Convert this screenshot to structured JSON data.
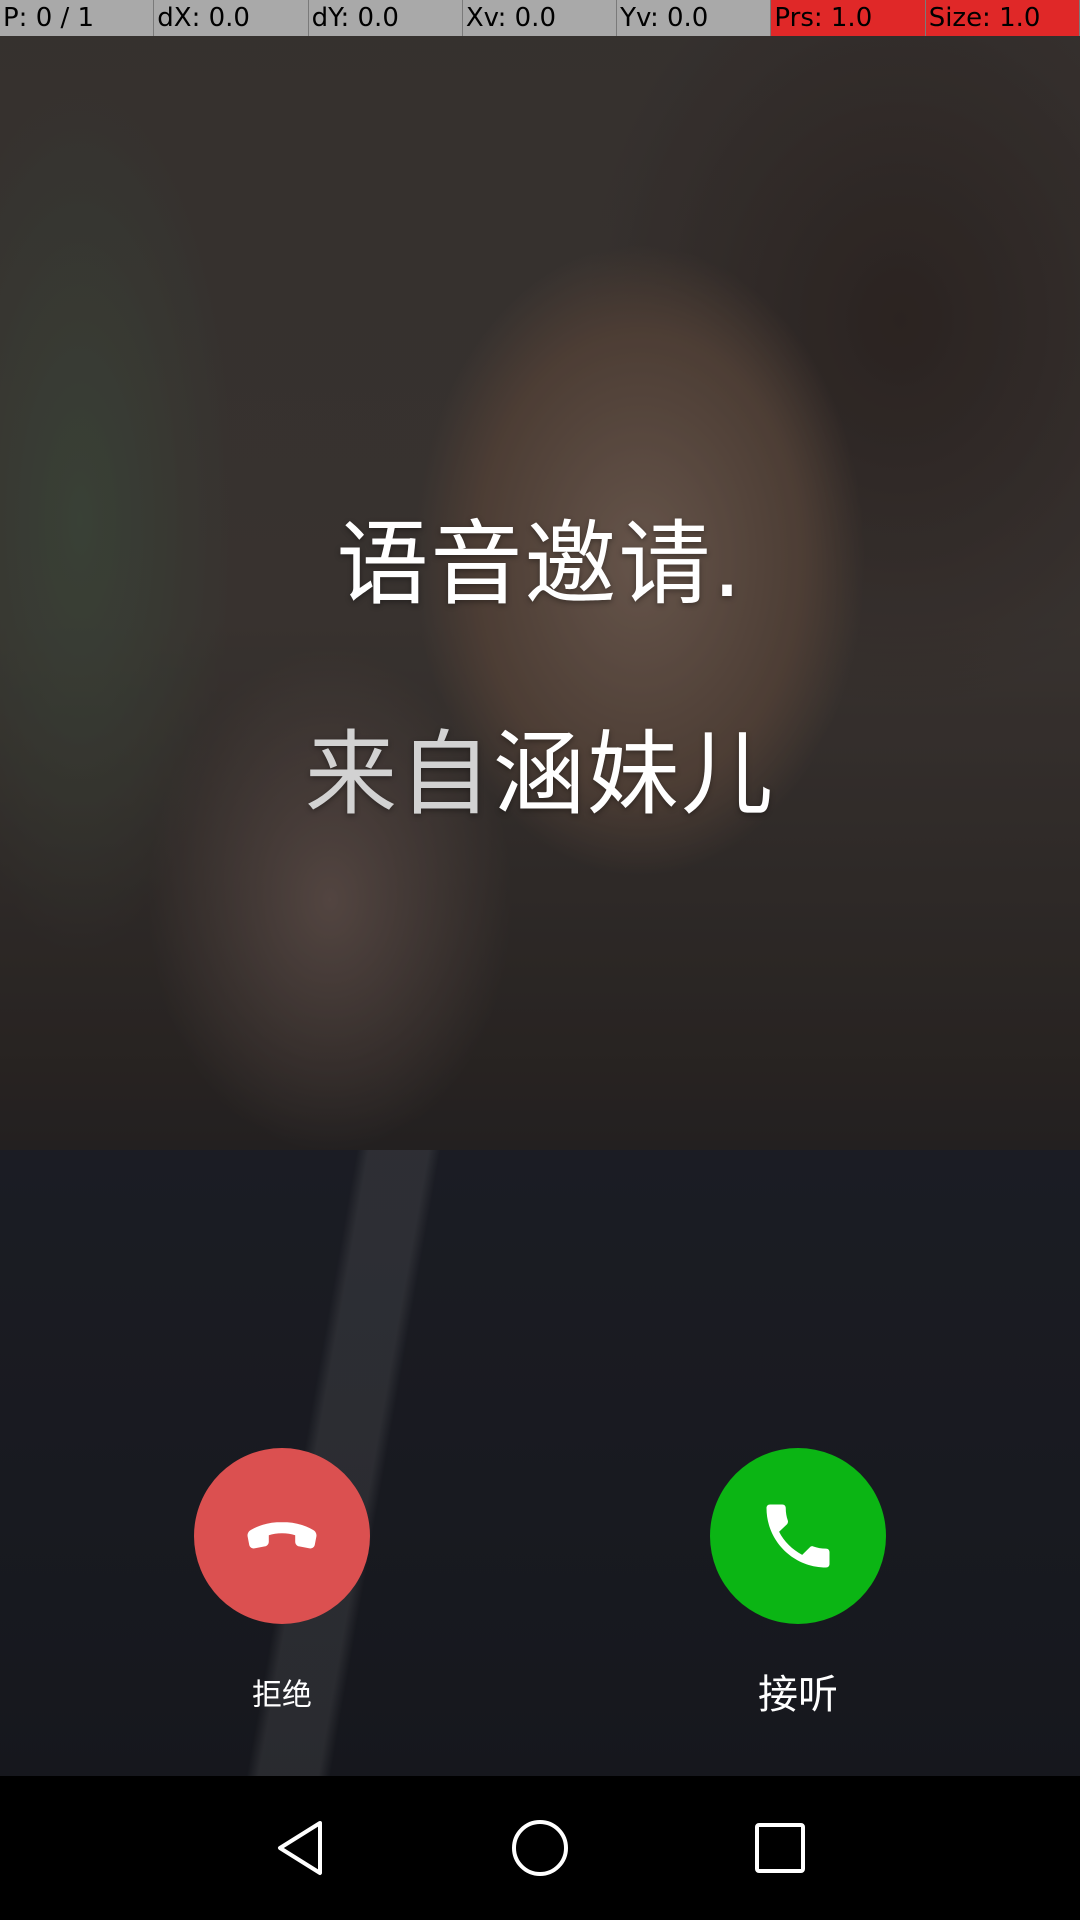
{
  "debug_bar": {
    "cells": [
      {
        "label": "P: 0 / 1"
      },
      {
        "label": "dX: 0.0"
      },
      {
        "label": "dY: 0.0"
      },
      {
        "label": "Xv: 0.0"
      },
      {
        "label": "Yv: 0.0"
      },
      {
        "label": "Prs: 1.0"
      },
      {
        "label": "Size: 1.0"
      }
    ],
    "alert_color": "#e02828",
    "normal_color": "#a9a9a9"
  },
  "call": {
    "title": "语音邀请.",
    "caller_prefix": "来自",
    "caller_name": "涵妹儿"
  },
  "actions": {
    "decline": {
      "label": "拒绝",
      "icon": "hang-up-phone-icon",
      "color": "#db5050"
    },
    "accept": {
      "label": "接听",
      "icon": "phone-icon",
      "color": "#0bb514"
    }
  },
  "nav": {
    "back_icon": "back-triangle-icon",
    "home_icon": "home-circle-icon",
    "recent_icon": "recent-apps-square-icon"
  }
}
